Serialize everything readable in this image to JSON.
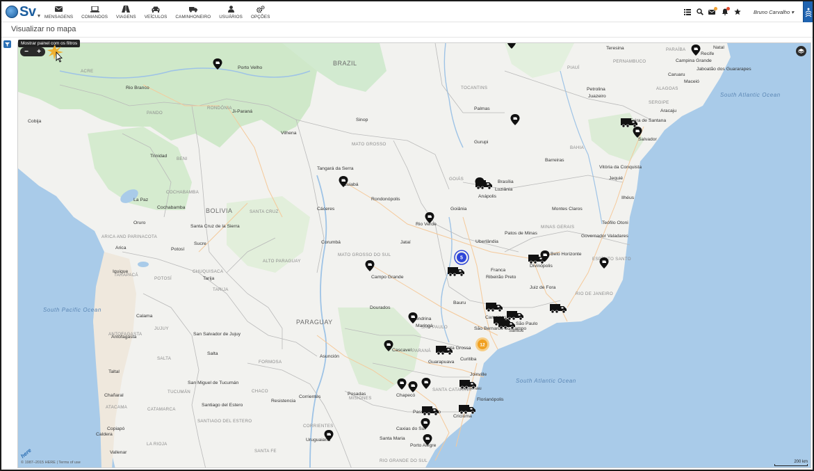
{
  "app": {
    "logo_text": "Sv",
    "user_name": "Bruno Carvalho"
  },
  "nav": {
    "items": [
      {
        "label": "MENSAGENS",
        "icon": "envelope-icon"
      },
      {
        "label": "COMANDOS",
        "icon": "laptop-icon"
      },
      {
        "label": "VIAGENS",
        "icon": "road-icon"
      },
      {
        "label": "VEÍCULOS",
        "icon": "car-icon"
      },
      {
        "label": "CAMINHONEIRO",
        "icon": "truck-icon"
      },
      {
        "label": "USUÁRIOS",
        "icon": "user-icon"
      },
      {
        "label": "OPÇÕES",
        "icon": "gears-icon"
      }
    ]
  },
  "toolbar": {
    "icons": [
      "list-icon",
      "search-icon",
      "mail-notification-icon",
      "alert-notification-icon",
      "star-icon"
    ]
  },
  "page": {
    "title": "Visualizar no mapa"
  },
  "map": {
    "tooltip": "Mostrar painel com os filtros",
    "zoom_out": "−",
    "zoom_in": "+",
    "attribution": "© 1987–2015 HERE | Terms of use",
    "provider": "here",
    "scale_label": "200 km",
    "clusters": [
      {
        "count": "5",
        "color": "#2f46d8"
      },
      {
        "count": "12",
        "color": "#f0a020"
      }
    ],
    "labels": {
      "countries": [
        "BRAZIL",
        "BOLIVIA",
        "PARAGUAY"
      ],
      "oceans": [
        "South Atlantic Ocean",
        "South Atlantic Ocean",
        "South Pacific Ocean"
      ],
      "regions": [
        "ACRE",
        "RONDÔNIA",
        "PANDO",
        "BENI",
        "MATO GROSSO",
        "GOIÁS",
        "MINAS GERAIS",
        "BAHIA",
        "TOCANTINS",
        "PIAUÍ",
        "PARAÍBA",
        "PERNAMBUCO",
        "ALAGOAS",
        "SERGIPE",
        "ESPÍRITO SANTO",
        "RIO DE JANEIRO",
        "SÃO PAULO",
        "PARANÁ",
        "SANTA CATARINA",
        "RIO GRANDE DO SUL",
        "MATO GROSSO DO SUL",
        "SANTA CRUZ",
        "COCHABAMBA",
        "CHUQUISACA",
        "POTOSÍ",
        "TARIJA",
        "ARICA AND PARINACOTA",
        "TARAPACÁ",
        "ANTOFAGASTA",
        "ATACAMA",
        "JUJUY",
        "SALTA",
        "FORMOSA",
        "CHACO",
        "TUCUMÁN",
        "CATAMARCA",
        "SANTIAGO DEL ESTERO",
        "CORRIENTES",
        "MISIONES",
        "SANTA FE",
        "LA RIOJA",
        "ALTO PARAGUAY"
      ],
      "cities": [
        "Rio Branco",
        "Cuiabá",
        "Goiânia",
        "Belo Horizonte",
        "Campo Grande",
        "Curitiba",
        "Porto Alegre",
        "Salvador",
        "Recife",
        "Maceió",
        "Aracaju",
        "Vitória da Conquista",
        "Uberlândia",
        "Ribeirão Preto",
        "Campinas",
        "São Paulo",
        "Santos",
        "São Bernardo do Campo",
        "Bauru",
        "Londrina",
        "Maringá",
        "Cascavel",
        "Joinville",
        "Blumenau",
        "Florianópolis",
        "Criciúma",
        "Caxias do Sul",
        "Santa Maria",
        "Chapecó",
        "Passo Fundo",
        "Uruguaiana",
        "Santa Cruz de la Sierra",
        "Sucre",
        "La Paz",
        "Asunción",
        "Resistencia",
        "Corrientes",
        "Posadas",
        "Salta",
        "San Salvador de Jujuy",
        "San Miguel de Tucumán",
        "Santiago del Estero",
        "Juiz de Fora",
        "Montes Claros",
        "Anápolis",
        "Rio Verde",
        "Jataí",
        "Patos de Minas",
        "Divinópolis",
        "Franca",
        "Feira de Santana",
        "Jequié",
        "Ilhéus",
        "Teófilo Otoni",
        "Governador Valadares",
        "Guarapuava",
        "Ponta Grossa",
        "Dourados",
        "Corumbá",
        "Rondonópolis",
        "Sinop",
        "Porto Velho",
        "Cobija",
        "Trinidad",
        "Cochabamba",
        "Oruro",
        "Potosí",
        "Tarija",
        "Arica",
        "Iquique",
        "Calama",
        "Antofagasta",
        "Taltal",
        "Chañaral",
        "Copiapó",
        "Vallenar",
        "Caldera",
        "Ji-Paraná",
        "Vilhena",
        "Cáceres",
        "Tangará da Serra",
        "Barreiras",
        "Teresina",
        "Petrolina",
        "Juazeiro",
        "Caruaru",
        "Campina Grande",
        "Natal",
        "Jaboatão dos Guararapes",
        "Palmas",
        "Gurupi",
        "Luziânia",
        "Brasília"
      ]
    }
  }
}
